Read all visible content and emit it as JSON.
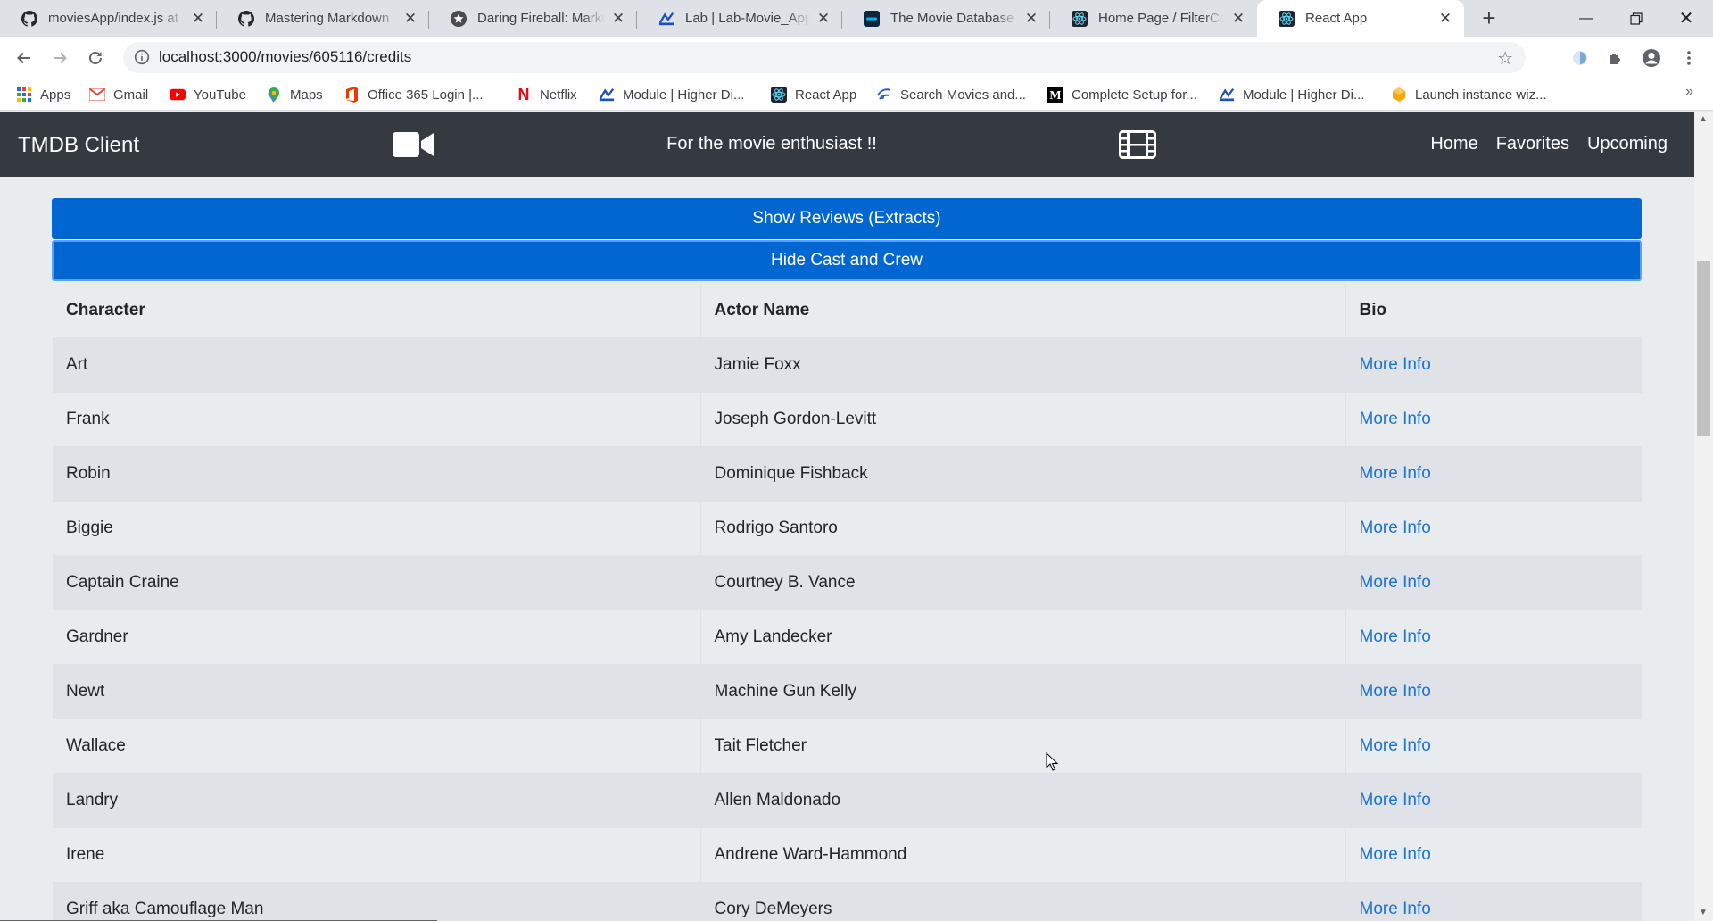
{
  "browser": {
    "tabs": [
      {
        "title": "moviesApp/index.js at",
        "icon": "github-icon",
        "active": false
      },
      {
        "title": "Mastering Markdown",
        "icon": "github-icon",
        "active": false
      },
      {
        "title": "Daring Fireball: Markdo",
        "icon": "star-icon",
        "active": false
      },
      {
        "title": "Lab | Lab-Movie_App-F",
        "icon": "module-icon",
        "active": false
      },
      {
        "title": "The Movie Database A",
        "icon": "tmdb-icon",
        "active": false
      },
      {
        "title": "Home Page / FilterCon",
        "icon": "react-icon",
        "active": false
      },
      {
        "title": "React App",
        "icon": "react-icon",
        "active": true
      }
    ],
    "url": "localhost:3000/movies/605116/credits",
    "bookmarks": [
      {
        "label": "Apps",
        "icon": "apps-grid-icon"
      },
      {
        "label": "Gmail",
        "icon": "gmail-icon"
      },
      {
        "label": "YouTube",
        "icon": "youtube-icon"
      },
      {
        "label": "Maps",
        "icon": "maps-icon"
      },
      {
        "label": "Office 365 Login |...",
        "icon": "office-icon"
      },
      {
        "label": "Netflix",
        "icon": "netflix-icon"
      },
      {
        "label": "Module | Higher Di...",
        "icon": "module-icon"
      },
      {
        "label": "React App",
        "icon": "react-icon"
      },
      {
        "label": "Search Movies and...",
        "icon": "search-movies-icon"
      },
      {
        "label": "Complete Setup for...",
        "icon": "medium-icon"
      },
      {
        "label": "Module | Higher Di...",
        "icon": "module-icon"
      },
      {
        "label": "Launch instance wiz...",
        "icon": "aws-icon"
      }
    ],
    "more_bookmarks": "»"
  },
  "app": {
    "brand": "TMDB Client",
    "tagline": "For the movie enthusiast !!",
    "nav": [
      "Home",
      "Favorites",
      "Upcoming"
    ],
    "reviews_button": "Show Reviews (Extracts)",
    "cast_button": "Hide Cast and Crew",
    "table": {
      "headers": [
        "Character",
        "Actor Name",
        "Bio"
      ],
      "rows": [
        {
          "character": "Art",
          "actor": "Jamie Foxx",
          "bio": "More Info"
        },
        {
          "character": "Frank",
          "actor": "Joseph Gordon-Levitt",
          "bio": "More Info"
        },
        {
          "character": "Robin",
          "actor": "Dominique Fishback",
          "bio": "More Info"
        },
        {
          "character": "Biggie",
          "actor": "Rodrigo Santoro",
          "bio": "More Info"
        },
        {
          "character": "Captain Craine",
          "actor": "Courtney B. Vance",
          "bio": "More Info"
        },
        {
          "character": "Gardner",
          "actor": "Amy Landecker",
          "bio": "More Info"
        },
        {
          "character": "Newt",
          "actor": "Machine Gun Kelly",
          "bio": "More Info"
        },
        {
          "character": "Wallace",
          "actor": "Tait Fletcher",
          "bio": "More Info"
        },
        {
          "character": "Landry",
          "actor": "Allen Maldonado",
          "bio": "More Info"
        },
        {
          "character": "Irene",
          "actor": "Andrene Ward-Hammond",
          "bio": "More Info"
        },
        {
          "character": "Griff aka Camouflage Man",
          "actor": "Cory DeMeyers",
          "bio": "More Info"
        }
      ]
    }
  },
  "colors": {
    "navbar": "#343a40",
    "primary_button": "#0066d1",
    "link": "#1a73d6",
    "page_background": "#e9ecef"
  }
}
